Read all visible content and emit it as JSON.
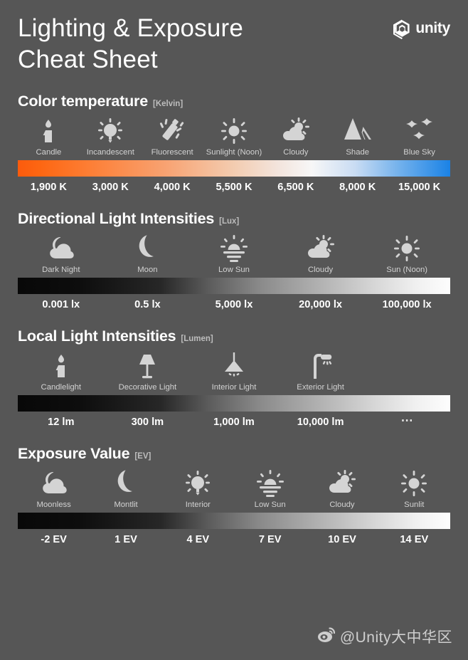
{
  "header": {
    "title": "Lighting & Exposure\nCheat Sheet",
    "brand_name": "unity",
    "brand_logo_icon": "unity-cube-icon"
  },
  "sections": [
    {
      "id": "color-temperature",
      "title": "Color temperature",
      "unit": "[Kelvin]",
      "bar_style": "kelvin-gradient",
      "items": [
        {
          "icon": "candle-icon",
          "label": "Candle",
          "value": "1,900 K"
        },
        {
          "icon": "lightbulb-icon",
          "label": "Incandescent",
          "value": "3,000 K"
        },
        {
          "icon": "fluorescent-icon",
          "label": "Fluorescent",
          "value": "4,000 K"
        },
        {
          "icon": "sun-icon",
          "label": "Sunlight (Noon)",
          "value": "5,500 K"
        },
        {
          "icon": "sun-cloud-icon",
          "label": "Cloudy",
          "value": "6,500 K"
        },
        {
          "icon": "house-shade-icon",
          "label": "Shade",
          "value": "8,000 K"
        },
        {
          "icon": "birds-icon",
          "label": "Blue Sky",
          "value": "15,000 K"
        }
      ]
    },
    {
      "id": "directional-light-intensities",
      "title": "Directional Light Intensities",
      "unit": "[Lux]",
      "bar_style": "gray-gradient",
      "items": [
        {
          "icon": "moon-cloud-icon",
          "label": "Dark Night",
          "value": "0.001 lx"
        },
        {
          "icon": "moon-icon",
          "label": "Moon",
          "value": "0.5 lx"
        },
        {
          "icon": "sunset-icon",
          "label": "Low Sun",
          "value": "5,000 lx"
        },
        {
          "icon": "sun-cloud-icon",
          "label": "Cloudy",
          "value": "20,000 lx"
        },
        {
          "icon": "sun-icon",
          "label": "Sun (Noon)",
          "value": "100,000 lx"
        }
      ]
    },
    {
      "id": "local-light-intensities",
      "title": "Local Light Intensities",
      "unit": "[Lumen]",
      "bar_style": "gray-gradient",
      "items": [
        {
          "icon": "candle-icon",
          "label": "Candlelight",
          "value": "12 lm"
        },
        {
          "icon": "table-lamp-icon",
          "label": "Decorative Light",
          "value": "300 lm"
        },
        {
          "icon": "pendant-lamp-icon",
          "label": "Interior Light",
          "value": "1,000 lm"
        },
        {
          "icon": "street-lamp-icon",
          "label": "Exterior Light",
          "value": "10,000 lm"
        },
        {
          "icon": "none",
          "label": "",
          "value": "⋯"
        }
      ]
    },
    {
      "id": "exposure-value",
      "title": "Exposure Value",
      "unit": "[EV]",
      "bar_style": "gray-gradient",
      "items": [
        {
          "icon": "moon-cloud-icon",
          "label": "Moonless",
          "value": "-2 EV"
        },
        {
          "icon": "moon-icon",
          "label": "Montlit",
          "value": "1 EV"
        },
        {
          "icon": "lightbulb-icon",
          "label": "Interior",
          "value": "4 EV"
        },
        {
          "icon": "sunset-icon",
          "label": "Low Sun",
          "value": "7 EV"
        },
        {
          "icon": "sun-cloud-icon",
          "label": "Cloudy",
          "value": "10 EV"
        },
        {
          "icon": "sun-icon",
          "label": "Sunlit",
          "value": "14 EV"
        }
      ]
    }
  ],
  "watermark": {
    "icon": "weibo-icon",
    "text": "@Unity大中华区"
  },
  "colors": {
    "background": "#565656",
    "title_text": "#ffffff",
    "label_text": "#d2d2d2",
    "unit_text": "#bdbdbd",
    "kelvin_warm": "#fc5b0d",
    "kelvin_cool": "#1a82e6"
  }
}
